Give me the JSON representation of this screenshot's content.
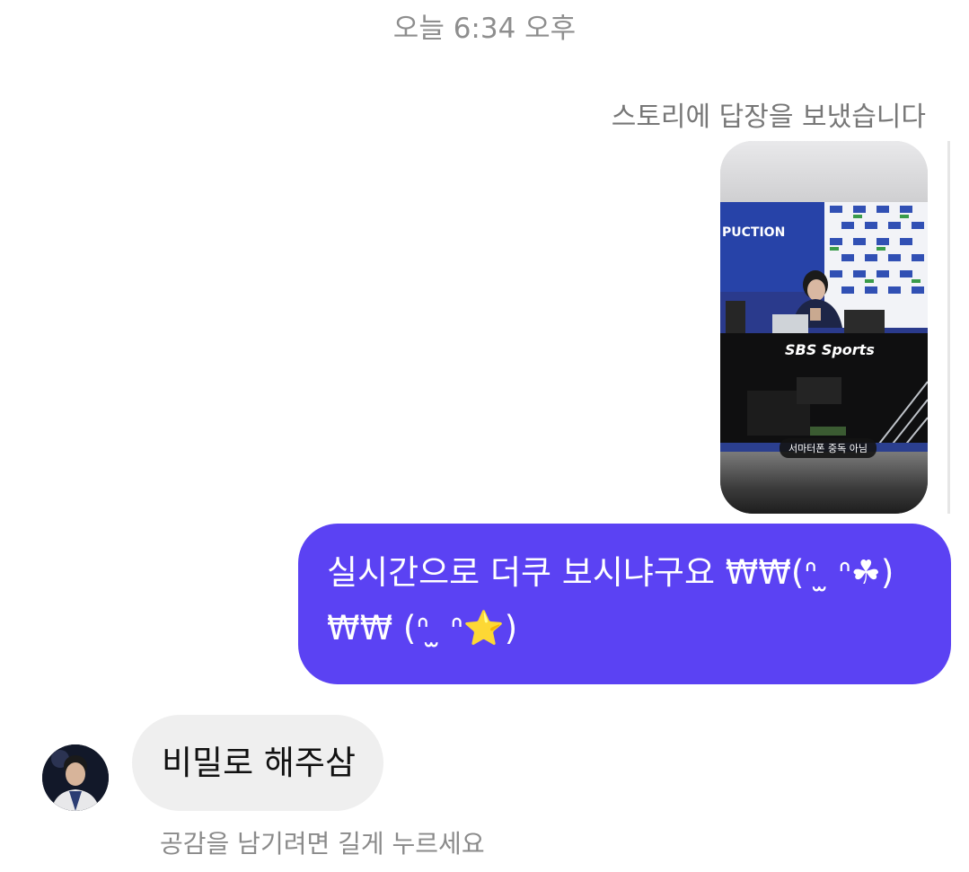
{
  "thread": {
    "timestamp": "오늘 6:34 오후",
    "story_reply": {
      "label": "스토리에 답장을 보냈습니다",
      "story_caption": "서마터폰 중독 아님",
      "story_logo_text": "SBS Sports",
      "story_banner_text": "PUCTION"
    },
    "sent_message": {
      "text": "실시간으로 더쿠 보시냐구요 ₩₩(ᐢ ̫ ᐢ☘)₩₩ (ᐢ ̫ ᐢ⭐)"
    },
    "received_message": {
      "text": "비밀로 해주삼"
    },
    "reaction_hint": "공감을 남기려면 길게 누르세요"
  },
  "colors": {
    "sent_bubble": "#5b42f3",
    "received_bubble": "#efefef",
    "secondary_text": "#8e8e8e"
  }
}
